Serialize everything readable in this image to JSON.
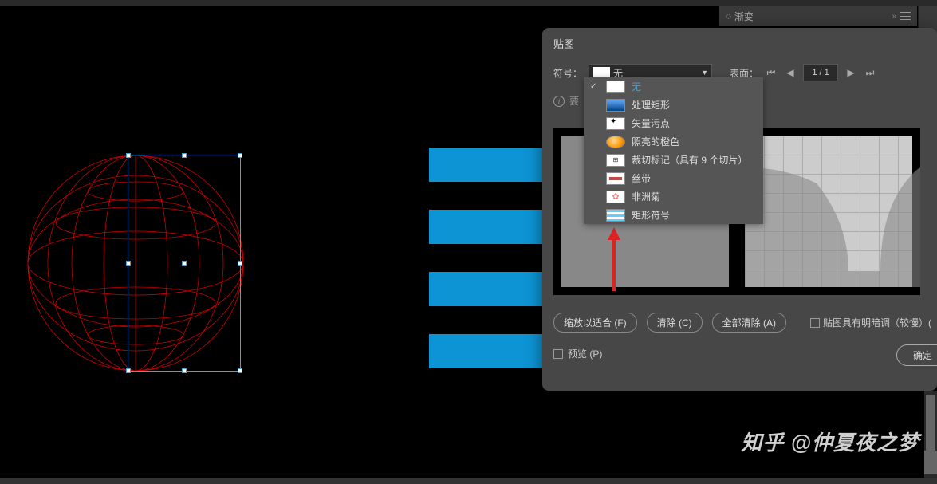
{
  "topTab": {
    "label": "渐变"
  },
  "dialog": {
    "title": "贴图",
    "symbolLabel": "符号：",
    "symbolSelected": "无",
    "surfaceLabel": "表面：",
    "pageDisplay": "1 / 1",
    "infoText": "要",
    "dropdown": [
      {
        "label": "无",
        "selected": true,
        "thumb": "none"
      },
      {
        "label": "处理矩形",
        "thumb": "blue-grad"
      },
      {
        "label": "矢量污点",
        "thumb": "ink"
      },
      {
        "label": "照亮的橙色",
        "thumb": "orange"
      },
      {
        "label": "裁切标记（具有 9 个切片）",
        "thumb": "crop"
      },
      {
        "label": "丝带",
        "thumb": "ribbon"
      },
      {
        "label": "非洲菊",
        "thumb": "flower"
      },
      {
        "label": "矩形符号",
        "thumb": "rect-sym"
      }
    ],
    "buttons": {
      "fit": "缩放以适合 (F)",
      "clear": "清除 (C)",
      "clearAll": "全部清除 (A)"
    },
    "shadingCheckbox": "贴图具有明暗调（较慢）(",
    "previewCheckbox": "预览 (P)",
    "okButton": "确定"
  },
  "watermark": "知乎 @仲夏夜之梦"
}
